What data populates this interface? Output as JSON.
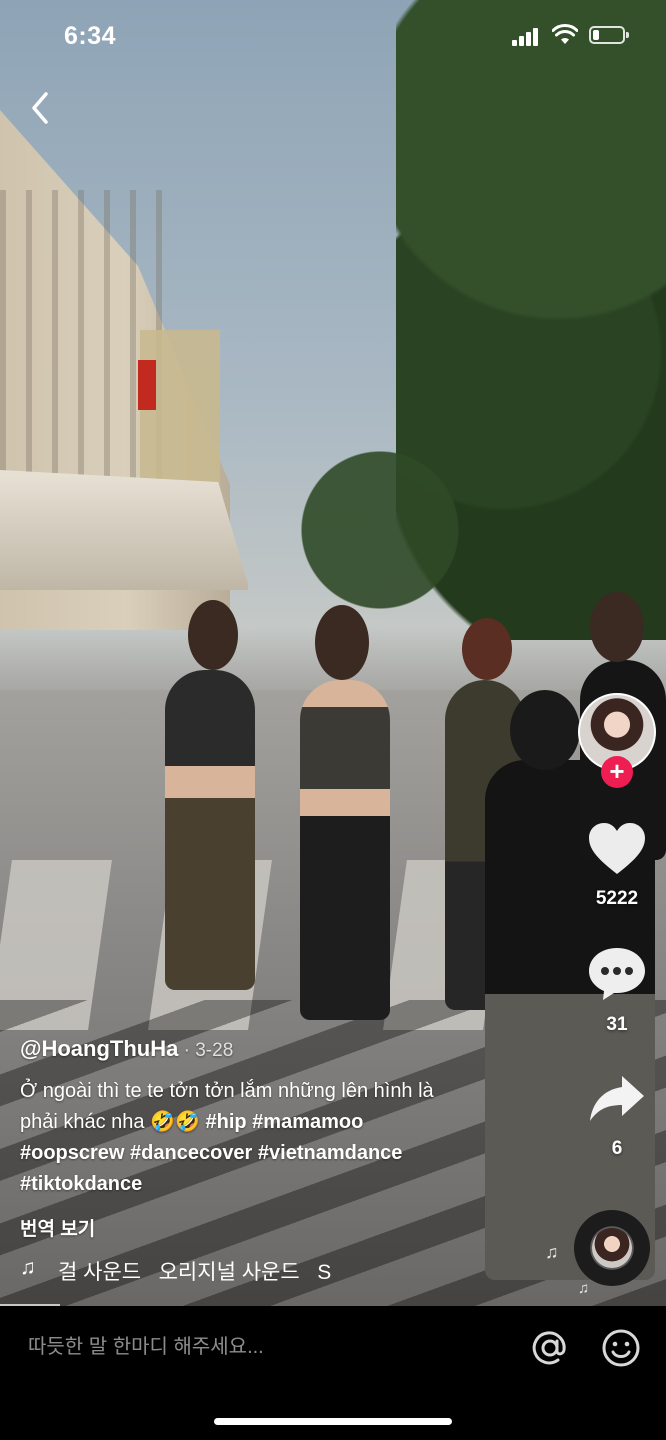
{
  "status_bar": {
    "time": "6:34",
    "battery_level": 0.2
  },
  "navigation": {
    "back_icon": "chevron-left-icon"
  },
  "creator": {
    "profile_icon": "avatar",
    "follow_symbol": "+"
  },
  "actions": {
    "like": {
      "icon": "heart-icon",
      "count": "5222"
    },
    "comment": {
      "icon": "comment-bubble-icon",
      "count": "31"
    },
    "share": {
      "icon": "share-arrow-icon",
      "count": "6"
    }
  },
  "post": {
    "username": "@HoangThuHa",
    "separator": " · ",
    "date": "3-28",
    "description_line1": "Ở ngoài thì te te tởn tởn lắm những lên hình là",
    "description_line2_text": "phải khác nha ",
    "emojis": "🤣🤣",
    "hashtags_line2": [
      "#hip",
      "#mamamoo"
    ],
    "hashtags_line3": [
      "#oopscrew",
      "#dancecover",
      "#vietnamdance"
    ],
    "hashtags_line4": [
      "#tiktokdance"
    ],
    "translate_label": "번역 보기"
  },
  "sound": {
    "icon": "music-note-icon",
    "marquee_text": "걸 사운드   오리지널 사운드   S"
  },
  "comment_bar": {
    "placeholder": "따듯한 말 한마디 해주세요...",
    "mention_icon": "at-sign-icon",
    "emoji_icon": "smiley-icon"
  }
}
